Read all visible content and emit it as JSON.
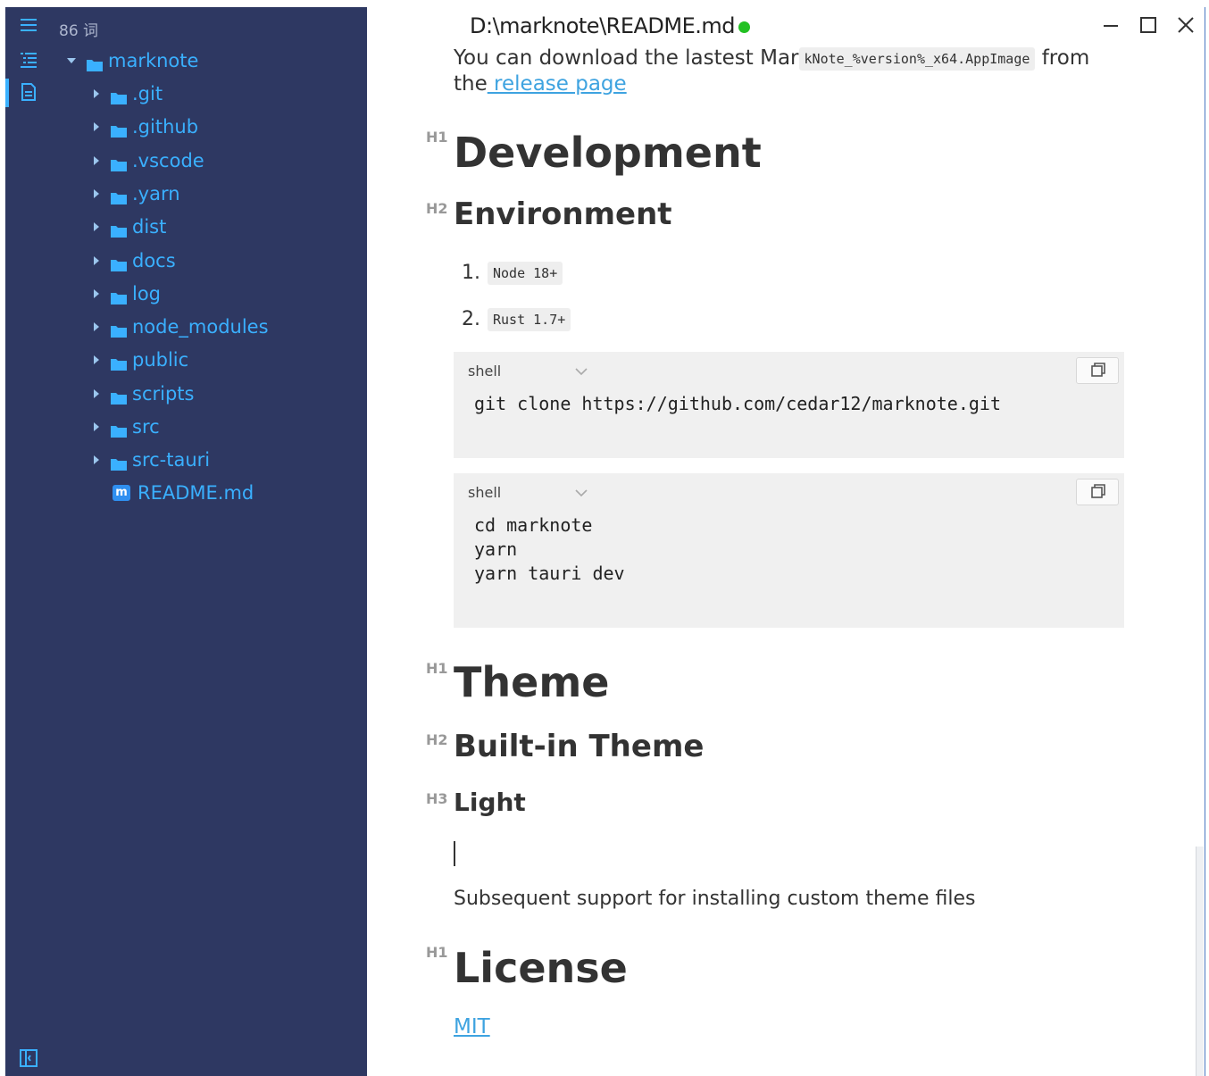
{
  "sidebar": {
    "word_count": "86 词",
    "tree": {
      "root": "marknote",
      "children": [
        ".git",
        ".github",
        ".vscode",
        ".yarn",
        "dist",
        "docs",
        "log",
        "node_modules",
        "public",
        "scripts",
        "src",
        "src-tauri"
      ],
      "file": "README.md",
      "file_icon_letter": "m"
    }
  },
  "rail": {
    "icons": [
      "menu-icon",
      "outline-icon",
      "file-icon",
      "sidebar-toggle-icon"
    ]
  },
  "window": {
    "title": "D:\\marknote\\README.md",
    "status_color": "#23c123"
  },
  "doc": {
    "intro_prefix": "You can download the lastest Mar",
    "intro_code": "kNote_%version%_x64.AppImage",
    "intro_suffix": " from",
    "intro_line2_prefix": "the",
    "intro_link": " release page",
    "h1_development": "Development",
    "h2_environment": "Environment",
    "list": [
      {
        "num": "1.",
        "code": "Node 18+"
      },
      {
        "num": "2.",
        "code": "Rust 1.7+"
      }
    ],
    "code_block_1": {
      "lang": "shell",
      "lines": [
        "git clone https://github.com/cedar12/marknote.git"
      ]
    },
    "code_block_2": {
      "lang": "shell",
      "lines": [
        "cd marknote",
        "yarn",
        "yarn tauri dev"
      ]
    },
    "h1_theme": "Theme",
    "h2_builtin": "Built-in Theme",
    "h3_light": "Light",
    "para_subsequent": "Subsequent support for installing custom theme files",
    "h1_license": "License",
    "license_link": "MIT",
    "heading_marks": {
      "h1": "H1",
      "h2": "H2",
      "h3": "H3"
    }
  },
  "colors": {
    "sidebar_bg": "#2e3862",
    "accent": "#3ab0ff",
    "link": "#3ea3e0"
  }
}
